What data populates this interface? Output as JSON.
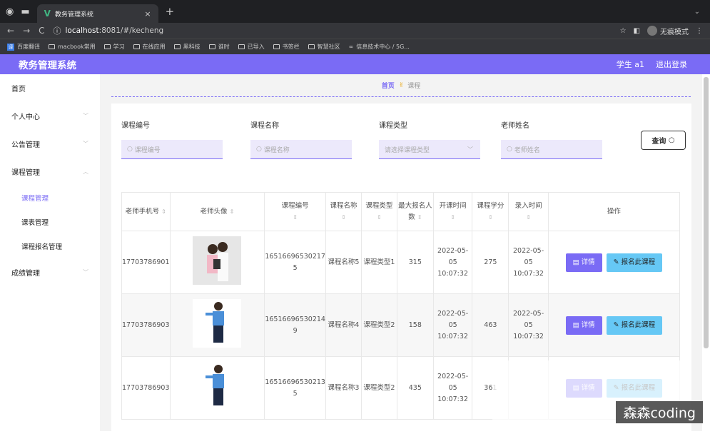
{
  "browser": {
    "tab_title": "教务管理系统",
    "url_host": "localhost",
    "url_rest": ":8081/#/kecheng",
    "incognito": "无痕模式",
    "bookmarks": [
      "百度翻译",
      "macbook常用",
      "学习",
      "在线应用",
      "黑科技",
      "谁时",
      "已导入",
      "书签栏",
      "智慧社区",
      "信息技术中心 / 5G..."
    ]
  },
  "header": {
    "title": "教务管理系统",
    "user": "学生 a1",
    "logout": "退出登录"
  },
  "sidebar": {
    "items": [
      "首页",
      "个人中心",
      "公告管理",
      "课程管理",
      "课程管理",
      "课表管理",
      "课程报名管理",
      "成绩管理"
    ]
  },
  "breadcrumb": {
    "home": "首页",
    "current": "课程"
  },
  "search": {
    "fields": [
      {
        "label": "课程编号",
        "placeholder": "课程编号"
      },
      {
        "label": "课程名称",
        "placeholder": "课程名称"
      },
      {
        "label": "课程类型",
        "placeholder": "请选择课程类型"
      },
      {
        "label": "老师姓名",
        "placeholder": "老师姓名"
      }
    ],
    "query": "查询"
  },
  "table": {
    "headers": [
      "老师手机号",
      "老师头像",
      "课程编号",
      "课程名称",
      "课程类型",
      "最大报名人数",
      "开课时间",
      "课程学分",
      "录入时间",
      "操作"
    ],
    "rows": [
      {
        "phone": "17703786901",
        "code": "16516696530217 5",
        "name": "课程名称5",
        "type": "课程类型1",
        "max": "315",
        "start": "2022-05-05 10:07:32",
        "credit": "275",
        "entry": "2022-05-05 10:07:32"
      },
      {
        "phone": "17703786903",
        "code": "16516696530214 9",
        "name": "课程名称4",
        "type": "课程类型2",
        "max": "158",
        "start": "2022-05-05 10:07:32",
        "credit": "463",
        "entry": "2022-05-05 10:07:32"
      },
      {
        "phone": "17703786903",
        "code": "16516696530213 5",
        "name": "课程名称3",
        "type": "课程类型2",
        "max": "435",
        "start": "2022-05-05 10:07:32",
        "credit": "361",
        "entry": ""
      }
    ],
    "detail": "详情",
    "enroll": "报名此课程"
  },
  "watermark": "森森coding"
}
